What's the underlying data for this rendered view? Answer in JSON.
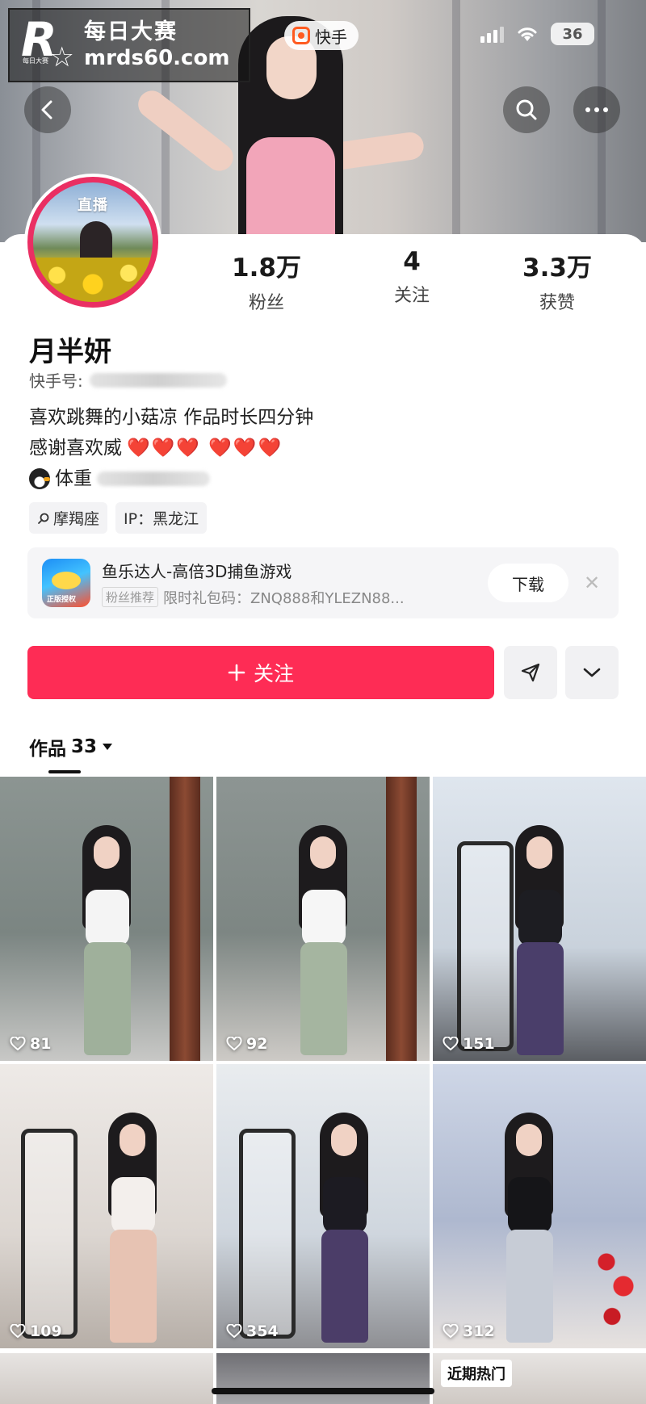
{
  "watermark": {
    "brand_cn": "每日大赛",
    "domain": "mrds60.com",
    "logo_letter": "R",
    "logo_small": "每日大赛"
  },
  "status_bar": {
    "battery": "36",
    "app_name": "快手"
  },
  "profile": {
    "live_label": "直播",
    "name": "月半妍",
    "kuaishou_id_label": "快手号:",
    "stats": [
      {
        "value": "1.8万",
        "label": "粉丝"
      },
      {
        "value": "4",
        "label": "关注"
      },
      {
        "value": "3.3万",
        "label": "获赞"
      }
    ],
    "bio_line1": "喜欢跳舞的小菇凉 作品时长四分钟",
    "bio_line2_text": "感谢喜欢威",
    "bio_line2_hearts": "❤️❤️❤️ ❤️❤️❤️",
    "bio_line3_text": "体重",
    "tags": [
      {
        "icon": "zodiac-icon",
        "label": "摩羯座"
      },
      {
        "icon": "",
        "label": "IP：黑龙江"
      }
    ]
  },
  "ad": {
    "title": "鱼乐达人-高倍3D捕鱼游戏",
    "badge": "粉丝推荐",
    "subtitle": "限时礼包码：ZNQ888和YLEZN88...",
    "download_label": "下载",
    "icon_caption": "正版授权"
  },
  "actions": {
    "follow_label": "关注"
  },
  "works_tab": {
    "label": "作品",
    "count": "33"
  },
  "videos": [
    {
      "likes": "81"
    },
    {
      "likes": "92"
    },
    {
      "likes": "151"
    },
    {
      "likes": "109"
    },
    {
      "likes": "354"
    },
    {
      "likes": "312"
    }
  ],
  "third_row": {
    "hot_label": "近期热门"
  },
  "colors": {
    "brand_pink": "#fe2c55",
    "avatar_ring": "#ea2f63"
  }
}
